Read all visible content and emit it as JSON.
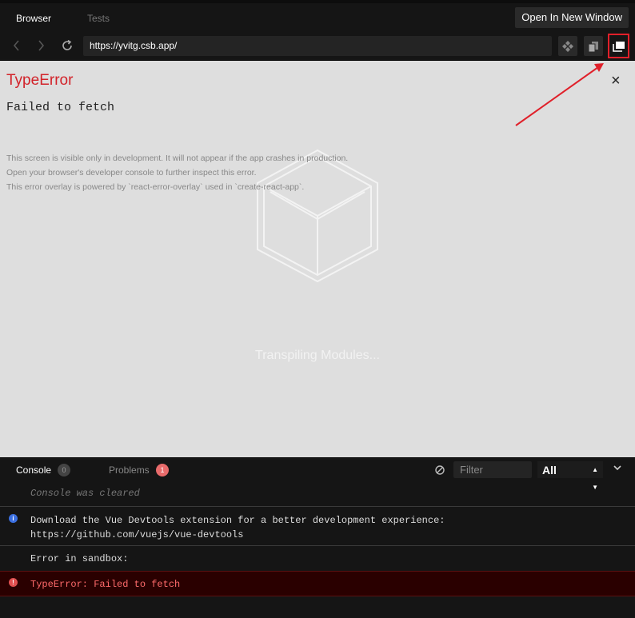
{
  "tabs": {
    "browser": "Browser",
    "tests": "Tests"
  },
  "toolbar": {
    "open_new_window": "Open In New Window"
  },
  "address": {
    "url": "https://yvitg.csb.app/"
  },
  "error_overlay": {
    "title": "TypeError",
    "message": "Failed to fetch",
    "close": "×",
    "notes": [
      "This screen is visible only in development. It will not appear if the app crashes in production.",
      "Open your browser's developer console to further inspect this error.",
      "This error overlay is powered by `react-error-overlay` used in `create-react-app`."
    ]
  },
  "loader": {
    "text": "Transpiling Modules..."
  },
  "console": {
    "tab_console": "Console",
    "console_count": "0",
    "tab_problems": "Problems",
    "problems_count": "1",
    "filter_placeholder": "Filter",
    "level": "All",
    "rows": {
      "cleared": "Console was cleared",
      "info_line1": "Download the Vue Devtools extension for a better development experience:",
      "info_line2": "https://github.com/vuejs/vue-devtools",
      "sandbox": "Error in sandbox:",
      "error": "TypeError: Failed to fetch"
    }
  },
  "colors": {
    "error_red": "#d2232a",
    "highlight": "#e0202a",
    "info_blue": "#3b6fe0"
  },
  "icons": [
    "chevron-left-icon",
    "chevron-right-icon",
    "reload-icon",
    "devtools-icon",
    "duplicate-icon",
    "new-window-icon",
    "clear-console-icon",
    "chevron-down-icon",
    "info-icon",
    "error-icon"
  ]
}
